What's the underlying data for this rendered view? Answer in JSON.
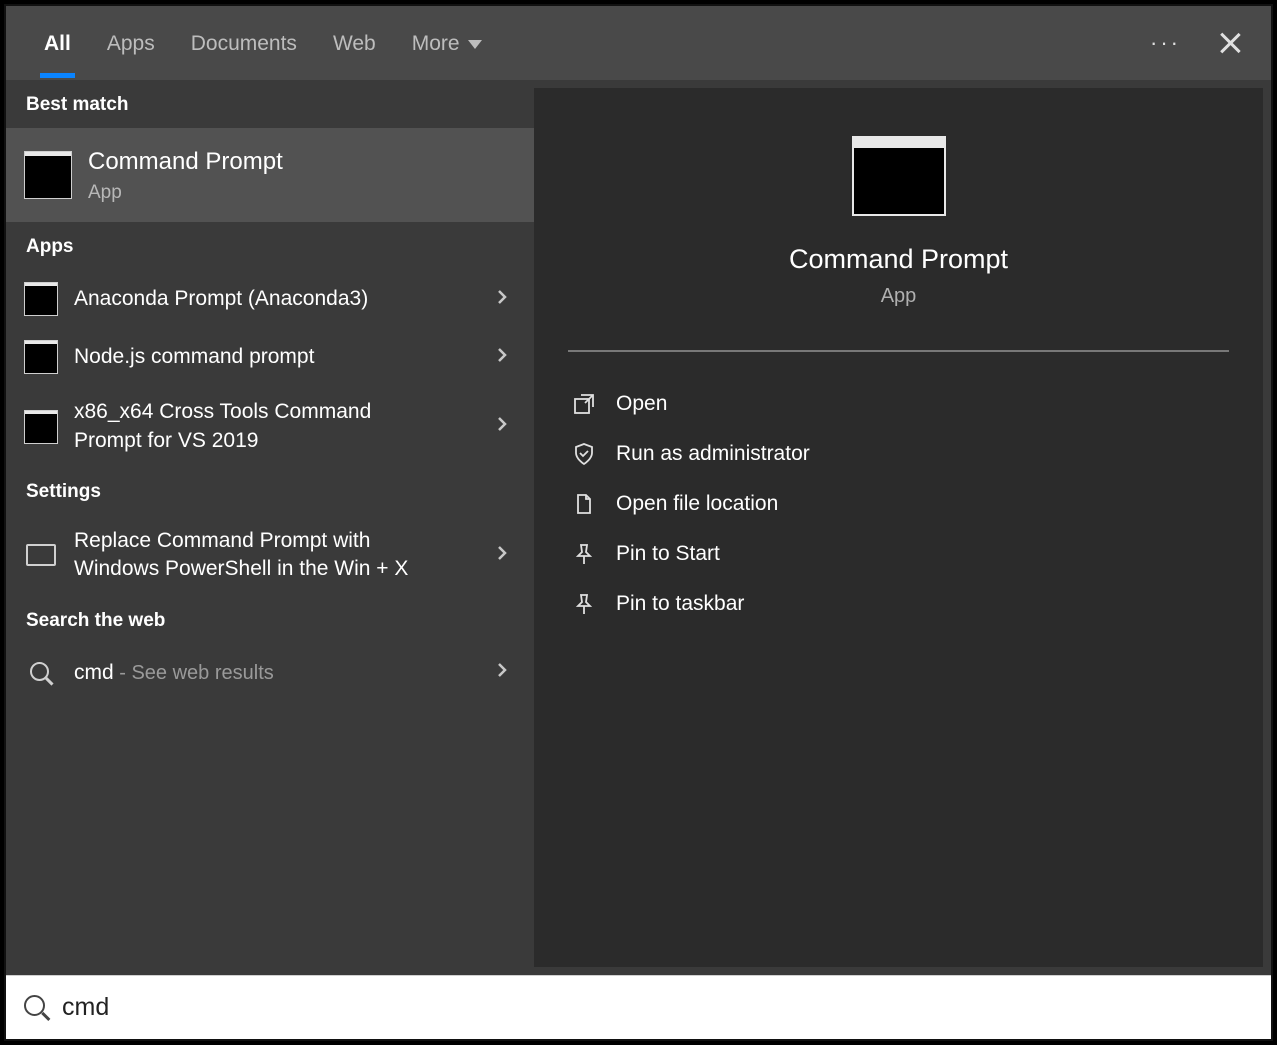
{
  "tabs": {
    "all": "All",
    "apps": "Apps",
    "documents": "Documents",
    "web": "Web",
    "more": "More"
  },
  "header": {
    "ellipsis": "···"
  },
  "left": {
    "best_match_header": "Best match",
    "best_match": {
      "title": "Command Prompt",
      "subtitle": "App"
    },
    "apps_header": "Apps",
    "apps": [
      {
        "title": "Anaconda Prompt (Anaconda3)"
      },
      {
        "title": "Node.js command prompt"
      },
      {
        "title": "x86_x64 Cross Tools Command Prompt for VS 2019"
      }
    ],
    "settings_header": "Settings",
    "settings": [
      {
        "title": "Replace Command Prompt with Windows PowerShell in the Win + X"
      }
    ],
    "web_header": "Search the web",
    "web": {
      "query": "cmd",
      "suffix": " - See web results"
    }
  },
  "preview": {
    "title": "Command Prompt",
    "subtitle": "App",
    "actions": {
      "open": "Open",
      "run_admin": "Run as administrator",
      "open_loc": "Open file location",
      "pin_start": "Pin to Start",
      "pin_taskbar": "Pin to taskbar"
    }
  },
  "search": {
    "value": "cmd"
  }
}
